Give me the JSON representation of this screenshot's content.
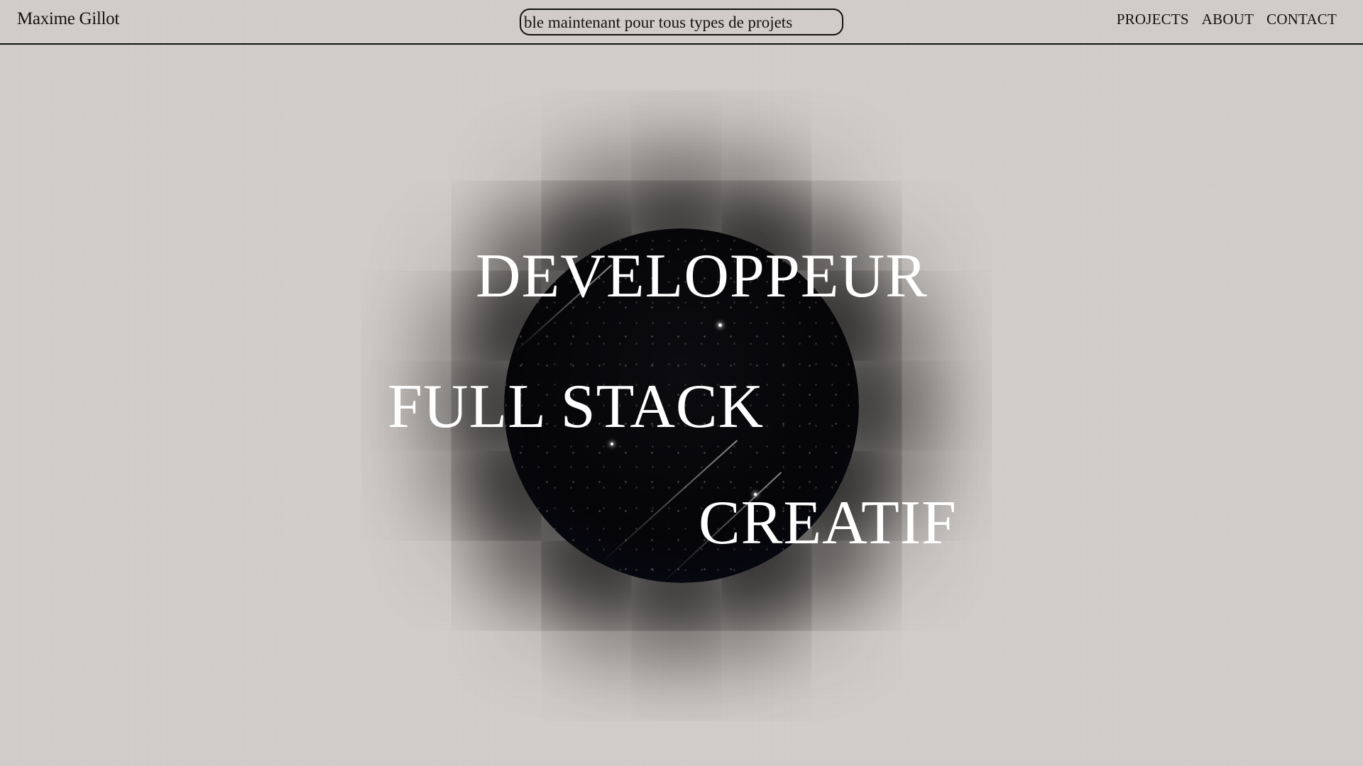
{
  "header": {
    "brand": "Maxime Gillot",
    "ticker_text": "ble maintenant pour tous types de projets",
    "nav": [
      {
        "label": "PROJECTS"
      },
      {
        "label": "ABOUT"
      },
      {
        "label": "CONTACT"
      }
    ]
  },
  "hero": {
    "line1": "DEVELOPPEUR",
    "line2": "FULL STACK",
    "line3": "CREATIF"
  },
  "colors": {
    "background": "#d3cecb",
    "text": "#141210",
    "orb": "#050507",
    "hero_text": "#ffffff"
  }
}
